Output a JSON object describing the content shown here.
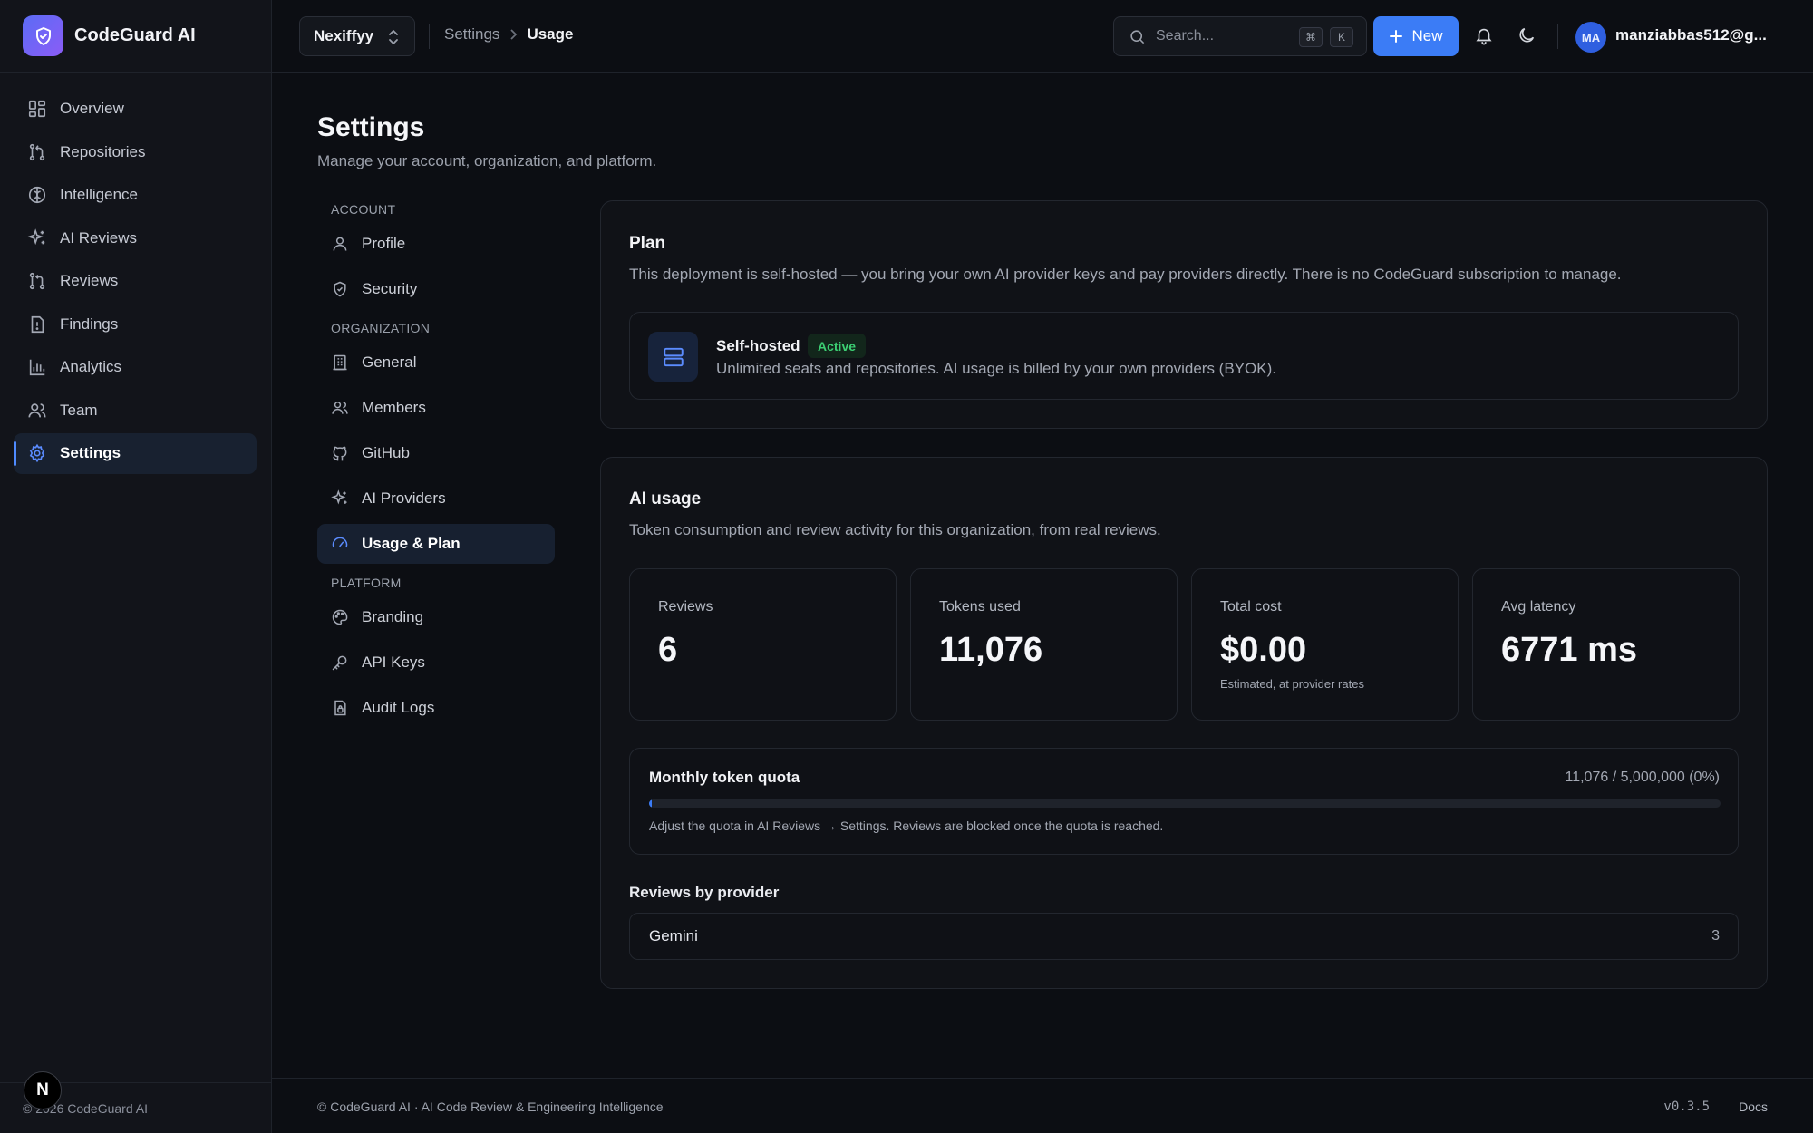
{
  "app": {
    "name": "CodeGuard AI",
    "footer_copyright": "© 2026 CodeGuard AI",
    "n_badge": "N"
  },
  "sidebar": {
    "items": [
      {
        "label": "Overview",
        "icon": "grid-icon"
      },
      {
        "label": "Repositories",
        "icon": "git-branch-icon"
      },
      {
        "label": "Intelligence",
        "icon": "brain-icon"
      },
      {
        "label": "AI Reviews",
        "icon": "sparkles-icon"
      },
      {
        "label": "Reviews",
        "icon": "git-pull-request-icon"
      },
      {
        "label": "Findings",
        "icon": "file-alert-icon"
      },
      {
        "label": "Analytics",
        "icon": "bar-chart-icon"
      },
      {
        "label": "Team",
        "icon": "users-icon"
      },
      {
        "label": "Settings",
        "icon": "gear-icon",
        "active": true
      }
    ]
  },
  "topbar": {
    "org": "Nexiffyy",
    "breadcrumb": [
      "Settings",
      "Usage"
    ],
    "search_placeholder": "Search...",
    "kbd_cmd": "⌘",
    "kbd_k": "K",
    "new_label": "New",
    "avatar_initials": "MA",
    "user_email": "manziabbas512@g..."
  },
  "page": {
    "title": "Settings",
    "subtitle": "Manage your account, organization, and platform."
  },
  "settings_nav": {
    "sections": [
      {
        "title": "ACCOUNT",
        "items": [
          {
            "label": "Profile",
            "icon": "user-icon"
          },
          {
            "label": "Security",
            "icon": "shield-icon"
          }
        ]
      },
      {
        "title": "ORGANIZATION",
        "items": [
          {
            "label": "General",
            "icon": "building-icon"
          },
          {
            "label": "Members",
            "icon": "users-icon"
          },
          {
            "label": "GitHub",
            "icon": "github-icon"
          },
          {
            "label": "AI Providers",
            "icon": "sparkles-icon"
          },
          {
            "label": "Usage & Plan",
            "icon": "gauge-icon",
            "active": true
          }
        ]
      },
      {
        "title": "PLATFORM",
        "items": [
          {
            "label": "Branding",
            "icon": "palette-icon"
          },
          {
            "label": "API Keys",
            "icon": "key-icon"
          },
          {
            "label": "Audit Logs",
            "icon": "file-lock-icon"
          }
        ]
      }
    ]
  },
  "plan": {
    "title": "Plan",
    "description": "This deployment is self-hosted — you bring your own AI provider keys and pay providers directly. There is no CodeGuard subscription to manage.",
    "name": "Self-hosted",
    "badge": "Active",
    "details": "Unlimited seats and repositories. AI usage is billed by your own providers (BYOK)."
  },
  "usage": {
    "title": "AI usage",
    "description": "Token consumption and review activity for this organization, from real reviews.",
    "stats": [
      {
        "label": "Reviews",
        "value": "6",
        "note": ""
      },
      {
        "label": "Tokens used",
        "value": "11,076",
        "note": ""
      },
      {
        "label": "Total cost",
        "value": "$0.00",
        "note": "Estimated, at provider rates"
      },
      {
        "label": "Avg latency",
        "value": "6771 ms",
        "note": ""
      }
    ],
    "quota": {
      "title": "Monthly token quota",
      "value": "11,076 / 5,000,000 (0%)",
      "fraction": 0.0022,
      "note": "Adjust the quota in AI Reviews → Settings. Reviews are blocked once the quota is reached."
    },
    "providers_heading": "Reviews by provider",
    "providers": [
      {
        "name": "Gemini",
        "count": "3"
      }
    ]
  },
  "footer": {
    "text": "© CodeGuard AI · AI Code Review & Engineering Intelligence",
    "version": "v0.3.5",
    "docs": "Docs"
  },
  "colors": {
    "accent": "#3b7cf6",
    "active_badge": "#3ccf73",
    "background": "#0c0e13"
  }
}
